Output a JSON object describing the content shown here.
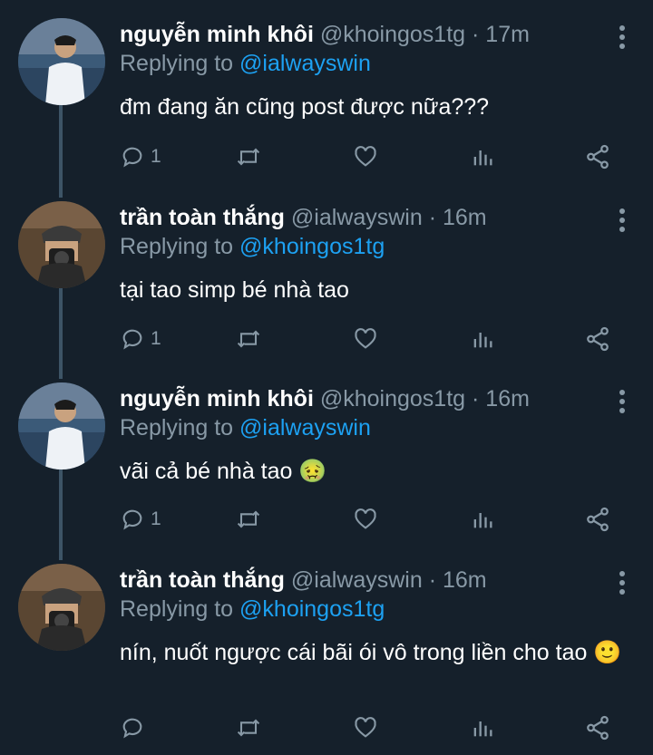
{
  "tweets": [
    {
      "name": "nguyễn minh khôi",
      "handle": "@khoingos1tg",
      "time": "· 17m",
      "replying_prefix": "Replying to",
      "replying_to": "@ialwayswin",
      "text": "đm đang ăn cũng post được nữa???",
      "reply_count": "1",
      "avatar": "avatar-photo-man-white-shirt"
    },
    {
      "name": "trần toàn thắng",
      "handle": "@ialwayswin",
      "time": "· 16m",
      "replying_prefix": "Replying to",
      "replying_to": "@khoingos1tg",
      "text": "tại tao simp bé nhà tao",
      "reply_count": "1",
      "avatar": "avatar-photo-man-camera"
    },
    {
      "name": "nguyễn minh khôi",
      "handle": "@khoingos1tg",
      "time": "· 16m",
      "replying_prefix": "Replying to",
      "replying_to": "@ialwayswin",
      "text": "vãi cả bé nhà tao 🤢",
      "reply_count": "1",
      "avatar": "avatar-photo-man-white-shirt"
    },
    {
      "name": "trần toàn thắng",
      "handle": "@ialwayswin",
      "time": "· 16m",
      "replying_prefix": "Replying to",
      "replying_to": "@khoingos1tg",
      "text": "nín, nuốt ngược cái bãi ói vô trong liền cho tao 🙂",
      "reply_count": "",
      "avatar": "avatar-photo-man-camera"
    }
  ],
  "icons": [
    "reply-icon",
    "retweet-icon",
    "like-icon",
    "analytics-icon",
    "share-icon",
    "more-icon"
  ],
  "colors": {
    "background": "#15202b",
    "text": "#ffffff",
    "secondary": "#8899a6",
    "link": "#1da1f2",
    "thread_line": "#3d5466"
  }
}
